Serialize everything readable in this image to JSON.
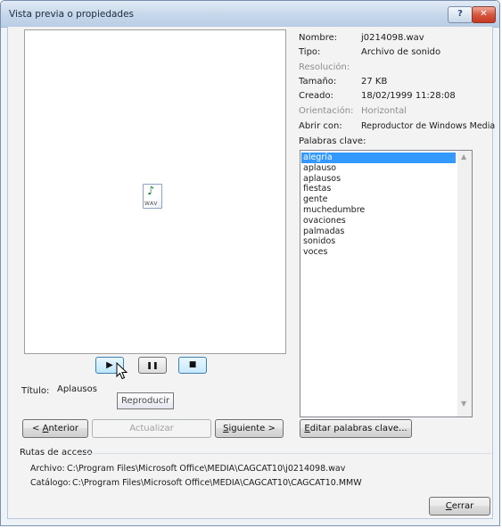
{
  "window": {
    "title": "Vista previa o propiedades",
    "help_glyph": "?",
    "close_glyph": "✕"
  },
  "preview": {
    "file_icon": "wav-file-icon",
    "file_icon_label": "WAV",
    "note_glyph": "♪"
  },
  "playback": {
    "play_glyph": "▶",
    "pause_glyph": "❚❚",
    "stop_glyph": "■",
    "tooltip": "Reproducir"
  },
  "title_field": {
    "label": "Título:",
    "value": "Aplausos"
  },
  "properties": {
    "name_label": "Nombre:",
    "name_value": "j0214098.wav",
    "type_label": "Tipo:",
    "type_value": "Archivo de sonido",
    "resolution_label": "Resolución:",
    "size_label": "Tamaño:",
    "size_value": "27 KB",
    "created_label": "Creado:",
    "created_value": "18/02/1999 11:28:08",
    "orientation_label": "Orientación:",
    "orientation_value": "Horizontal",
    "open_with_label": "Abrir con:",
    "open_with_value": "Reproductor de Windows Media"
  },
  "keywords": {
    "label": "Palabras clave:",
    "items": [
      "alegría",
      "aplauso",
      "aplausos",
      "fiestas",
      "gente",
      "muchedumbre",
      "ovaciones",
      "palmadas",
      "sonidos",
      "voces"
    ],
    "selected_index": 0
  },
  "buttons": {
    "prev_prefix": "< ",
    "prev_mnemonic": "A",
    "prev_rest": "nterior",
    "update": "Actualizar",
    "next_mnemonic": "S",
    "next_rest": "iguiente >",
    "edit_mnemonic": "E",
    "edit_rest": "ditar palabras clave...",
    "close_mnemonic": "C",
    "close_rest": "errar"
  },
  "paths": {
    "heading": "Rutas de acceso",
    "file_label": "Archivo:",
    "file_value": "C:\\Program Files\\Microsoft Office\\MEDIA\\CAGCAT10\\j0214098.wav",
    "catalog_label": "Catálogo:",
    "catalog_value": "C:\\Program Files\\Microsoft Office\\MEDIA\\CAGCAT10\\CAGCAT10.MMW"
  }
}
